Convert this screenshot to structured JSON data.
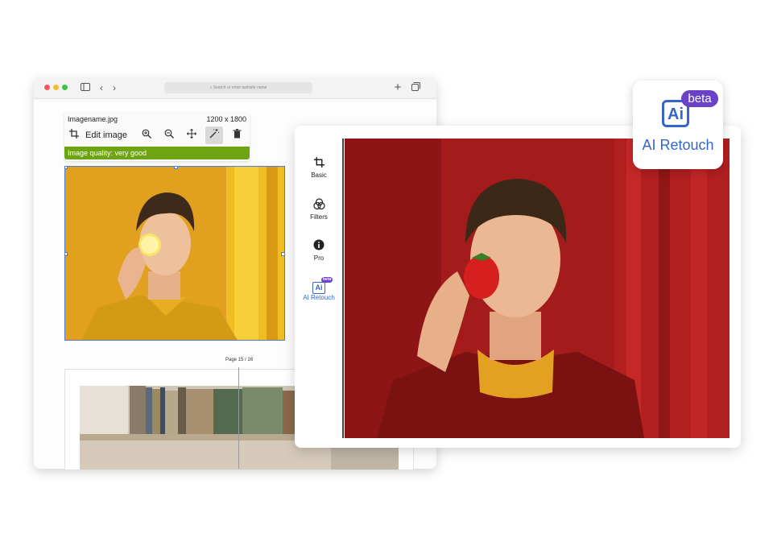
{
  "browser": {
    "url_placeholder": "Search or enter website name",
    "icons": {
      "sidebar": "sidebar-toggle-icon",
      "back": "chevron-left-icon",
      "forward": "chevron-right-icon",
      "new_tab": "plus-icon",
      "tabs": "tabs-icon"
    }
  },
  "editor": {
    "filename": "Imagename.jpg",
    "dimensions": "1200 x 1800",
    "edit_label": "Edit image",
    "quality_text": "Image quality: very good",
    "quality_color": "#6ea312",
    "icons": [
      "crop-icon",
      "zoom-in-icon",
      "zoom-out-icon",
      "move-icon",
      "magic-wand-icon",
      "trash-icon"
    ]
  },
  "document": {
    "page_label": "Page 15 / 16"
  },
  "side_toolbar": {
    "items": [
      {
        "label": "Basic",
        "icon": "crop-icon"
      },
      {
        "label": "Filters",
        "icon": "filters-icon"
      },
      {
        "label": "Pro",
        "icon": "info-icon"
      },
      {
        "label": "AI Retouch",
        "icon": "ai-icon",
        "badge": "beta"
      }
    ]
  },
  "ai_badge": {
    "box_text": "Ai",
    "beta": "beta",
    "label": "AI Retouch",
    "color": "#3466c9",
    "beta_color": "#6a42c8"
  }
}
